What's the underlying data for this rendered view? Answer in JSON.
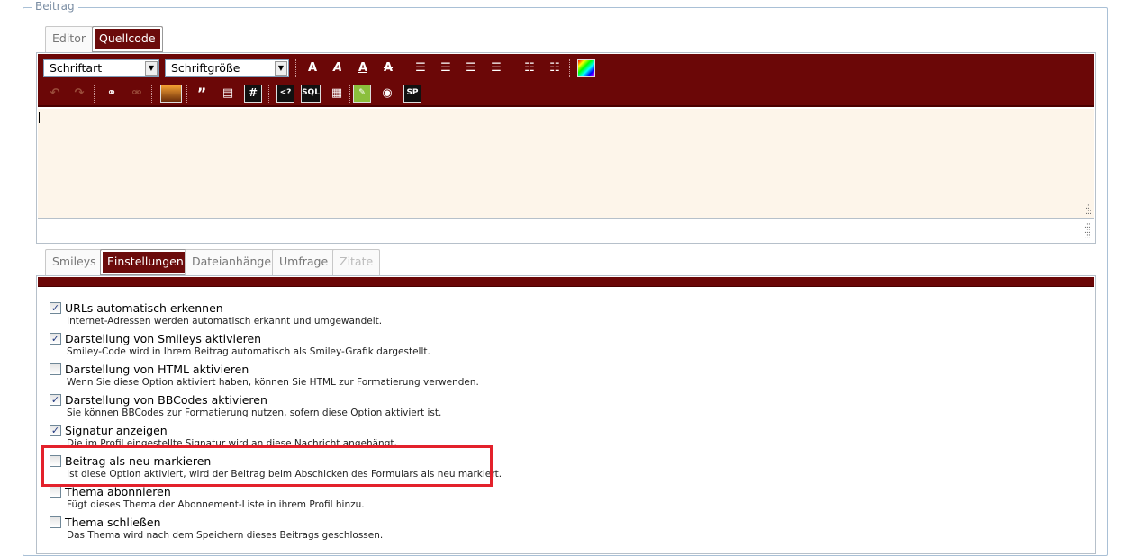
{
  "fieldset": {
    "legend": "Beitrag"
  },
  "editor_tabs": [
    {
      "label": "Editor",
      "active": false
    },
    {
      "label": "Quellcode",
      "active": true
    }
  ],
  "toolbar": {
    "font_select": "Schriftart",
    "size_select": "Schriftgröße",
    "quote_label": "”",
    "code_label": "#",
    "php_label": "<?",
    "sql_label": "SQL",
    "sp_label": "SP"
  },
  "settings_tabs": [
    {
      "label": "Smileys",
      "active": false
    },
    {
      "label": "Einstellungen",
      "active": true
    },
    {
      "label": "Dateianhänge",
      "active": false
    },
    {
      "label": "Umfrage",
      "active": false
    },
    {
      "label": "Zitate",
      "disabled": true
    }
  ],
  "options": [
    {
      "label": "URLs automatisch erkennen",
      "desc": "Internet-Adressen werden automatisch erkannt und umgewandelt.",
      "checked": true
    },
    {
      "label": "Darstellung von Smileys aktivieren",
      "desc": "Smiley-Code wird in Ihrem Beitrag automatisch als Smiley-Grafik dargestellt.",
      "checked": true
    },
    {
      "label": "Darstellung von HTML aktivieren",
      "desc": "Wenn Sie diese Option aktiviert haben, können Sie HTML zur Formatierung verwenden.",
      "checked": false
    },
    {
      "label": "Darstellung von BBCodes aktivieren",
      "desc": "Sie können BBCodes zur Formatierung nutzen, sofern diese Option aktiviert ist.",
      "checked": true
    },
    {
      "label": "Signatur anzeigen",
      "desc": "Die im Profil eingestellte Signatur wird an diese Nachricht angehängt.",
      "checked": true
    },
    {
      "label": "Beitrag als neu markieren",
      "desc": "Ist diese Option aktiviert, wird der Beitrag beim Abschicken des Formulars als neu markiert.",
      "checked": false
    },
    {
      "label": "Thema abonnieren",
      "desc": "Fügt dieses Thema der Abonnement-Liste in ihrem Profil hinzu.",
      "checked": false
    },
    {
      "label": "Thema schließen",
      "desc": "Das Thema wird nach dem Speichern dieses Beitrags geschlossen.",
      "checked": false
    }
  ],
  "check_mark": "✓",
  "colors": {
    "accent": "#6b0707",
    "highlight": "#e3212b"
  }
}
